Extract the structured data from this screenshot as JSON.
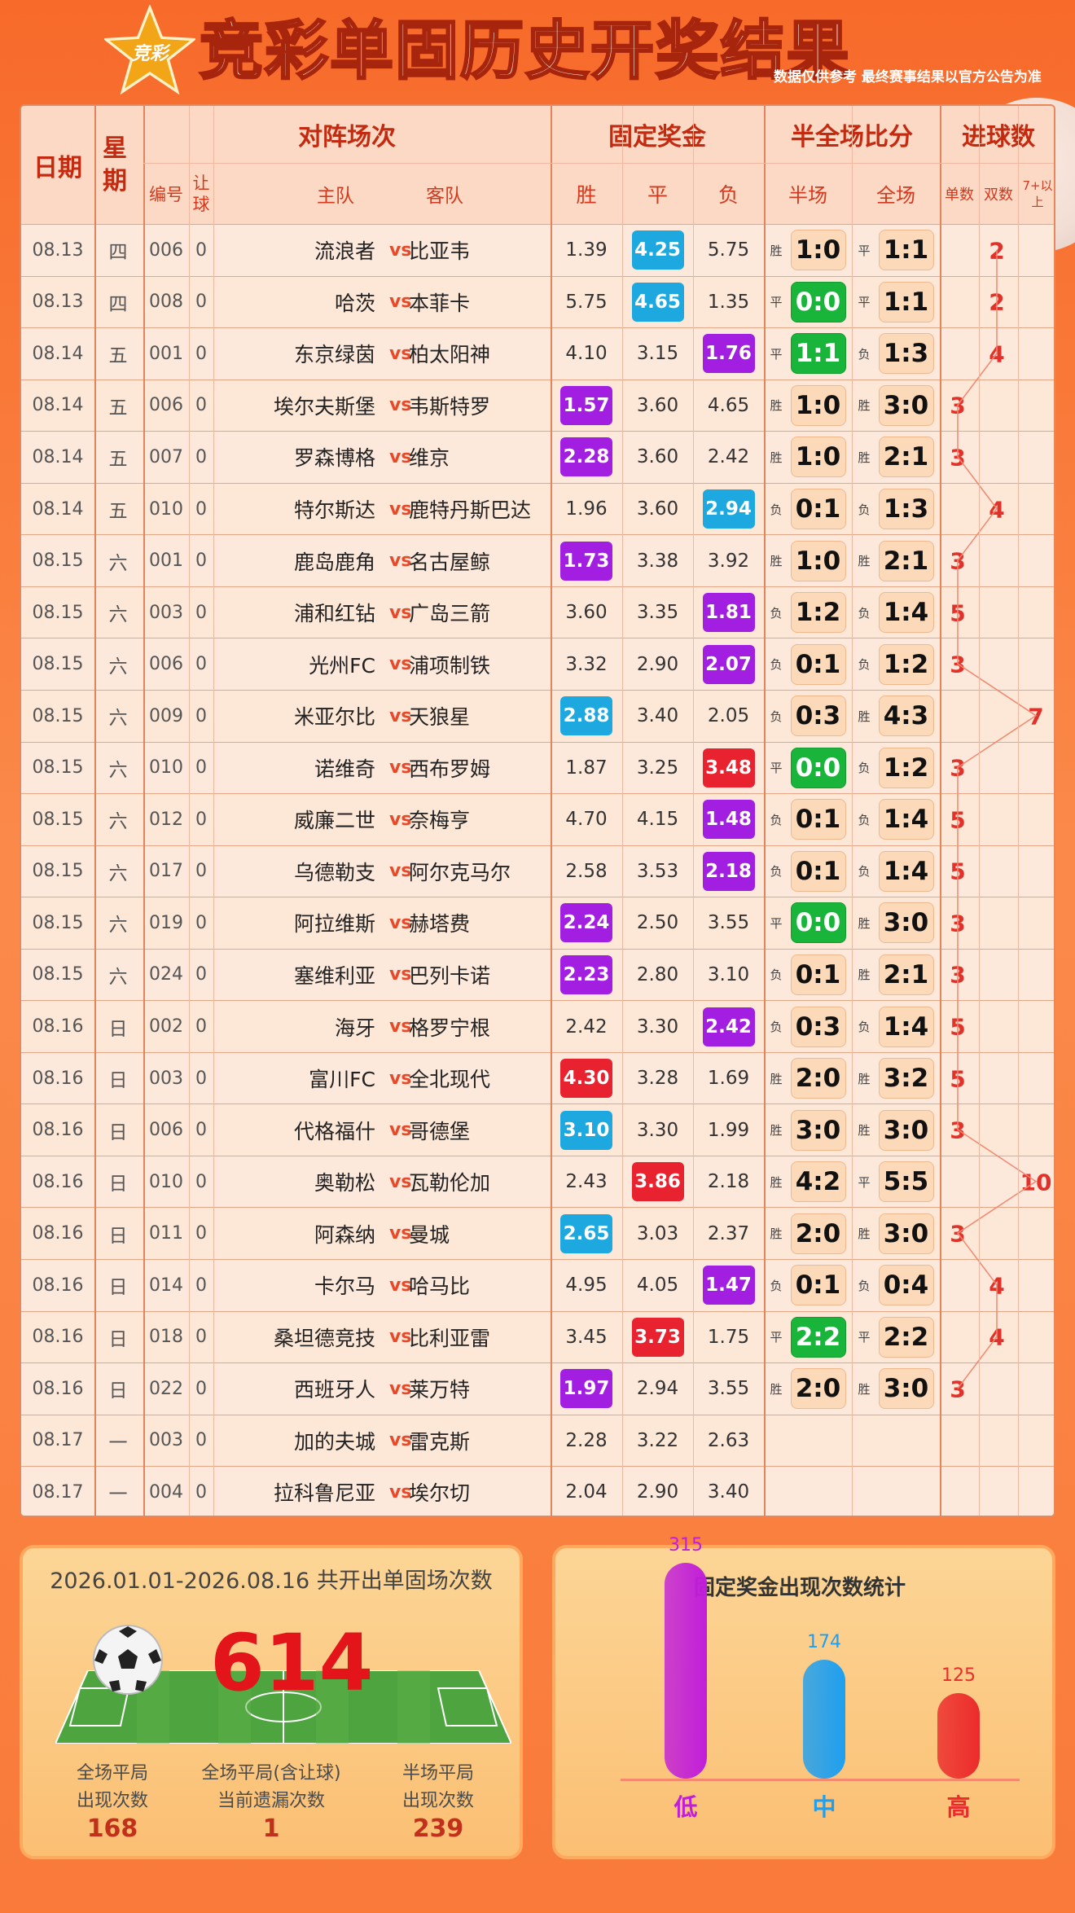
{
  "header": {
    "logo_text": "竞彩",
    "title": "竞彩单固历史开奖结果",
    "note": "数据仅供参考 最终赛事结果以官方公告为准"
  },
  "table": {
    "headers": {
      "date": "日期",
      "weekday": "星期",
      "match": "对阵场次",
      "fixed_prize": "固定奖金",
      "half_full": "半全场比分",
      "goals": "进球数"
    },
    "subheaders": {
      "number": "编号",
      "handicap": "让球",
      "home": "主队",
      "away": "客队",
      "win": "胜",
      "draw": "平",
      "lose": "负",
      "half": "半场",
      "full": "全场",
      "odd": "单数",
      "even": "双数",
      "seven_plus": "7+以上"
    },
    "vs_label": "vs",
    "rows": [
      {
        "date": "08.13",
        "wd": "四",
        "no": "006",
        "hc": "0",
        "home": "流浪者",
        "away": "比亚韦",
        "win": "1.39",
        "draw": "4.25",
        "lose": "5.75",
        "hi": "draw",
        "hic": "#1ea8e0",
        "htag": "胜",
        "half": "1:0",
        "hg": false,
        "ftag": "平",
        "full": "1:1",
        "fg": false,
        "goals": "2",
        "gcol": "even"
      },
      {
        "date": "08.13",
        "wd": "四",
        "no": "008",
        "hc": "0",
        "home": "哈茨",
        "away": "本菲卡",
        "win": "5.75",
        "draw": "4.65",
        "lose": "1.35",
        "hi": "draw",
        "hic": "#1ea8e0",
        "htag": "平",
        "half": "0:0",
        "hg": true,
        "ftag": "平",
        "full": "1:1",
        "fg": false,
        "goals": "2",
        "gcol": "even"
      },
      {
        "date": "08.14",
        "wd": "五",
        "no": "001",
        "hc": "0",
        "home": "东京绿茵",
        "away": "柏太阳神",
        "win": "4.10",
        "draw": "3.15",
        "lose": "1.76",
        "hi": "lose",
        "hic": "#a21ee0",
        "htag": "平",
        "half": "1:1",
        "hg": true,
        "ftag": "负",
        "full": "1:3",
        "fg": false,
        "goals": "4",
        "gcol": "even"
      },
      {
        "date": "08.14",
        "wd": "五",
        "no": "006",
        "hc": "0",
        "home": "埃尔夫斯堡",
        "away": "韦斯特罗",
        "win": "1.57",
        "draw": "3.60",
        "lose": "4.65",
        "hi": "win",
        "hic": "#a21ee0",
        "htag": "胜",
        "half": "1:0",
        "hg": false,
        "ftag": "胜",
        "full": "3:0",
        "fg": false,
        "goals": "3",
        "gcol": "odd"
      },
      {
        "date": "08.14",
        "wd": "五",
        "no": "007",
        "hc": "0",
        "home": "罗森博格",
        "away": "维京",
        "win": "2.28",
        "draw": "3.60",
        "lose": "2.42",
        "hi": "win",
        "hic": "#a21ee0",
        "htag": "胜",
        "half": "1:0",
        "hg": false,
        "ftag": "胜",
        "full": "2:1",
        "fg": false,
        "goals": "3",
        "gcol": "odd"
      },
      {
        "date": "08.14",
        "wd": "五",
        "no": "010",
        "hc": "0",
        "home": "特尔斯达",
        "away": "鹿特丹斯巴达",
        "win": "1.96",
        "draw": "3.60",
        "lose": "2.94",
        "hi": "lose",
        "hic": "#1ea8e0",
        "htag": "负",
        "half": "0:1",
        "hg": false,
        "ftag": "负",
        "full": "1:3",
        "fg": false,
        "goals": "4",
        "gcol": "even"
      },
      {
        "date": "08.15",
        "wd": "六",
        "no": "001",
        "hc": "0",
        "home": "鹿岛鹿角",
        "away": "名古屋鲸",
        "win": "1.73",
        "draw": "3.38",
        "lose": "3.92",
        "hi": "win",
        "hic": "#a21ee0",
        "htag": "胜",
        "half": "1:0",
        "hg": false,
        "ftag": "胜",
        "full": "2:1",
        "fg": false,
        "goals": "3",
        "gcol": "odd"
      },
      {
        "date": "08.15",
        "wd": "六",
        "no": "003",
        "hc": "0",
        "home": "浦和红钻",
        "away": "广岛三箭",
        "win": "3.60",
        "draw": "3.35",
        "lose": "1.81",
        "hi": "lose",
        "hic": "#a21ee0",
        "htag": "负",
        "half": "1:2",
        "hg": false,
        "ftag": "负",
        "full": "1:4",
        "fg": false,
        "goals": "5",
        "gcol": "odd"
      },
      {
        "date": "08.15",
        "wd": "六",
        "no": "006",
        "hc": "0",
        "home": "光州FC",
        "away": "浦项制铁",
        "win": "3.32",
        "draw": "2.90",
        "lose": "2.07",
        "hi": "lose",
        "hic": "#a21ee0",
        "htag": "负",
        "half": "0:1",
        "hg": false,
        "ftag": "负",
        "full": "1:2",
        "fg": false,
        "goals": "3",
        "gcol": "odd"
      },
      {
        "date": "08.15",
        "wd": "六",
        "no": "009",
        "hc": "0",
        "home": "米亚尔比",
        "away": "天狼星",
        "win": "2.88",
        "draw": "3.40",
        "lose": "2.05",
        "hi": "win",
        "hic": "#1ea8e0",
        "htag": "负",
        "half": "0:3",
        "hg": false,
        "ftag": "胜",
        "full": "4:3",
        "fg": false,
        "goals": "7",
        "gcol": "seven"
      },
      {
        "date": "08.15",
        "wd": "六",
        "no": "010",
        "hc": "0",
        "home": "诺维奇",
        "away": "西布罗姆",
        "win": "1.87",
        "draw": "3.25",
        "lose": "3.48",
        "hi": "lose",
        "hic": "#e8232f",
        "htag": "平",
        "half": "0:0",
        "hg": true,
        "ftag": "负",
        "full": "1:2",
        "fg": false,
        "goals": "3",
        "gcol": "odd"
      },
      {
        "date": "08.15",
        "wd": "六",
        "no": "012",
        "hc": "0",
        "home": "威廉二世",
        "away": "奈梅亨",
        "win": "4.70",
        "draw": "4.15",
        "lose": "1.48",
        "hi": "lose",
        "hic": "#a21ee0",
        "htag": "负",
        "half": "0:1",
        "hg": false,
        "ftag": "负",
        "full": "1:4",
        "fg": false,
        "goals": "5",
        "gcol": "odd"
      },
      {
        "date": "08.15",
        "wd": "六",
        "no": "017",
        "hc": "0",
        "home": "乌德勒支",
        "away": "阿尔克马尔",
        "win": "2.58",
        "draw": "3.53",
        "lose": "2.18",
        "hi": "lose",
        "hic": "#a21ee0",
        "htag": "负",
        "half": "0:1",
        "hg": false,
        "ftag": "负",
        "full": "1:4",
        "fg": false,
        "goals": "5",
        "gcol": "odd"
      },
      {
        "date": "08.15",
        "wd": "六",
        "no": "019",
        "hc": "0",
        "home": "阿拉维斯",
        "away": "赫塔费",
        "win": "2.24",
        "draw": "2.50",
        "lose": "3.55",
        "hi": "win",
        "hic": "#a21ee0",
        "htag": "平",
        "half": "0:0",
        "hg": true,
        "ftag": "胜",
        "full": "3:0",
        "fg": false,
        "goals": "3",
        "gcol": "odd"
      },
      {
        "date": "08.15",
        "wd": "六",
        "no": "024",
        "hc": "0",
        "home": "塞维利亚",
        "away": "巴列卡诺",
        "win": "2.23",
        "draw": "2.80",
        "lose": "3.10",
        "hi": "win",
        "hic": "#a21ee0",
        "htag": "负",
        "half": "0:1",
        "hg": false,
        "ftag": "胜",
        "full": "2:1",
        "fg": false,
        "goals": "3",
        "gcol": "odd"
      },
      {
        "date": "08.16",
        "wd": "日",
        "no": "002",
        "hc": "0",
        "home": "海牙",
        "away": "格罗宁根",
        "win": "2.42",
        "draw": "3.30",
        "lose": "2.42",
        "hi": "lose",
        "hic": "#a21ee0",
        "htag": "负",
        "half": "0:3",
        "hg": false,
        "ftag": "负",
        "full": "1:4",
        "fg": false,
        "goals": "5",
        "gcol": "odd"
      },
      {
        "date": "08.16",
        "wd": "日",
        "no": "003",
        "hc": "0",
        "home": "富川FC",
        "away": "全北现代",
        "win": "4.30",
        "draw": "3.28",
        "lose": "1.69",
        "hi": "win",
        "hic": "#e8232f",
        "htag": "胜",
        "half": "2:0",
        "hg": false,
        "ftag": "胜",
        "full": "3:2",
        "fg": false,
        "goals": "5",
        "gcol": "odd"
      },
      {
        "date": "08.16",
        "wd": "日",
        "no": "006",
        "hc": "0",
        "home": "代格福什",
        "away": "哥德堡",
        "win": "3.10",
        "draw": "3.30",
        "lose": "1.99",
        "hi": "win",
        "hic": "#1ea8e0",
        "htag": "胜",
        "half": "3:0",
        "hg": false,
        "ftag": "胜",
        "full": "3:0",
        "fg": false,
        "goals": "3",
        "gcol": "odd"
      },
      {
        "date": "08.16",
        "wd": "日",
        "no": "010",
        "hc": "0",
        "home": "奥勒松",
        "away": "瓦勒伦加",
        "win": "2.43",
        "draw": "3.86",
        "lose": "2.18",
        "hi": "draw",
        "hic": "#e8232f",
        "htag": "胜",
        "half": "4:2",
        "hg": false,
        "ftag": "平",
        "full": "5:5",
        "fg": false,
        "goals": "10",
        "gcol": "seven"
      },
      {
        "date": "08.16",
        "wd": "日",
        "no": "011",
        "hc": "0",
        "home": "阿森纳",
        "away": "曼城",
        "win": "2.65",
        "draw": "3.03",
        "lose": "2.37",
        "hi": "win",
        "hic": "#1ea8e0",
        "htag": "胜",
        "half": "2:0",
        "hg": false,
        "ftag": "胜",
        "full": "3:0",
        "fg": false,
        "goals": "3",
        "gcol": "odd"
      },
      {
        "date": "08.16",
        "wd": "日",
        "no": "014",
        "hc": "0",
        "home": "卡尔马",
        "away": "哈马比",
        "win": "4.95",
        "draw": "4.05",
        "lose": "1.47",
        "hi": "lose",
        "hic": "#a21ee0",
        "htag": "负",
        "half": "0:1",
        "hg": false,
        "ftag": "负",
        "full": "0:4",
        "fg": false,
        "goals": "4",
        "gcol": "even"
      },
      {
        "date": "08.16",
        "wd": "日",
        "no": "018",
        "hc": "0",
        "home": "桑坦德竞技",
        "away": "比利亚雷",
        "win": "3.45",
        "draw": "3.73",
        "lose": "1.75",
        "hi": "draw",
        "hic": "#e8232f",
        "htag": "平",
        "half": "2:2",
        "hg": true,
        "ftag": "平",
        "full": "2:2",
        "fg": false,
        "goals": "4",
        "gcol": "even"
      },
      {
        "date": "08.16",
        "wd": "日",
        "no": "022",
        "hc": "0",
        "home": "西班牙人",
        "away": "莱万特",
        "win": "1.97",
        "draw": "2.94",
        "lose": "3.55",
        "hi": "win",
        "hic": "#a21ee0",
        "htag": "胜",
        "half": "2:0",
        "hg": false,
        "ftag": "胜",
        "full": "3:0",
        "fg": false,
        "goals": "3",
        "gcol": "odd"
      },
      {
        "date": "08.17",
        "wd": "一",
        "no": "003",
        "hc": "0",
        "home": "加的夫城",
        "away": "雷克斯",
        "win": "2.28",
        "draw": "3.22",
        "lose": "2.63",
        "hi": "",
        "hic": "",
        "htag": "",
        "half": "",
        "hg": false,
        "ftag": "",
        "full": "",
        "fg": false,
        "goals": "",
        "gcol": ""
      },
      {
        "date": "08.17",
        "wd": "一",
        "no": "004",
        "hc": "0",
        "home": "拉科鲁尼亚",
        "away": "埃尔切",
        "win": "2.04",
        "draw": "2.90",
        "lose": "3.40",
        "hi": "",
        "hic": "",
        "htag": "",
        "half": "",
        "hg": false,
        "ftag": "",
        "full": "",
        "fg": false,
        "goals": "",
        "gcol": ""
      }
    ]
  },
  "summary": {
    "title": "2026.01.01-2026.08.16 共开出单固场次数",
    "count": "614",
    "stats": [
      {
        "label1": "全场平局",
        "label2": "出现次数",
        "value": "168"
      },
      {
        "label1": "全场平局(含让球)",
        "label2": "当前遗漏次数",
        "value": "1"
      },
      {
        "label1": "半场平局",
        "label2": "出现次数",
        "value": "239"
      }
    ]
  },
  "prize_chart": {
    "title": "固定奖金出现次数统计",
    "chart_data": {
      "type": "bar",
      "categories": [
        "低",
        "中",
        "高"
      ],
      "values": [
        315,
        174,
        125
      ],
      "colors": [
        "#c11ed9",
        "#1e9ff0",
        "#ec2b2b"
      ],
      "title": "固定奖金出现次数统计"
    }
  }
}
